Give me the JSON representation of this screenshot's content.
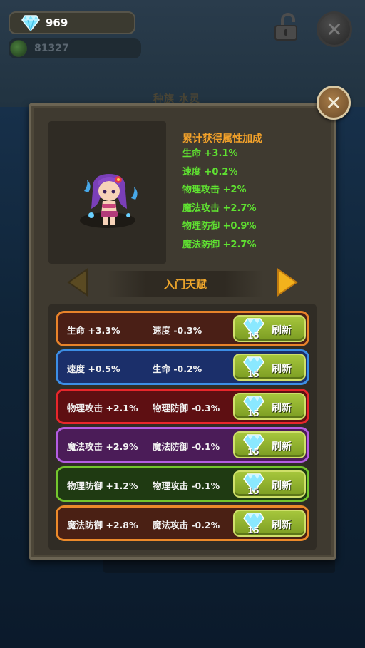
{
  "header": {
    "gems": "969",
    "orbs": "81327"
  },
  "background": {
    "title": "种族  水灵"
  },
  "panel": {
    "bonus_title": "累计获得属性加成",
    "bonuses": [
      "生命 +3.1%",
      "速度 +0.2%",
      "物理攻击 +2%",
      "魔法攻击 +2.7%",
      "物理防御 +0.9%",
      "魔法防御 +2.7%"
    ],
    "talent_name": "入门天赋",
    "rows": [
      {
        "stat1": "生命 +3.3%",
        "stat2": "速度 -0.3%",
        "cost": "15",
        "button": "刷新",
        "color": "#e8832a",
        "fill": "#4a1f16"
      },
      {
        "stat1": "速度 +0.5%",
        "stat2": "生命 -0.2%",
        "cost": "15",
        "button": "刷新",
        "color": "#3c8ee6",
        "fill": "#1b2f6a"
      },
      {
        "stat1": "物理攻击 +2.1%",
        "stat2": "物理防御 -0.3%",
        "cost": "15",
        "button": "刷新",
        "color": "#e8262b",
        "fill": "#5e0f12"
      },
      {
        "stat1": "魔法攻击 +2.9%",
        "stat2": "魔法防御 -0.1%",
        "cost": "15",
        "button": "刷新",
        "color": "#b45de2",
        "fill": "#4b1c58"
      },
      {
        "stat1": "物理防御 +1.2%",
        "stat2": "物理攻击 -0.1%",
        "cost": "15",
        "button": "刷新",
        "color": "#74c62e",
        "fill": "#1f3a12"
      },
      {
        "stat1": "魔法防御 +2.8%",
        "stat2": "魔法攻击 -0.2%",
        "cost": "15",
        "button": "刷新",
        "color": "#ec8a2a",
        "fill": "#4a2014"
      }
    ]
  },
  "icons": {
    "gem": "diamond-icon",
    "orb": "green-orb-icon",
    "lock": "unlock-icon",
    "close": "close-icon",
    "prev": "arrow-left-icon",
    "next": "arrow-right-icon"
  }
}
